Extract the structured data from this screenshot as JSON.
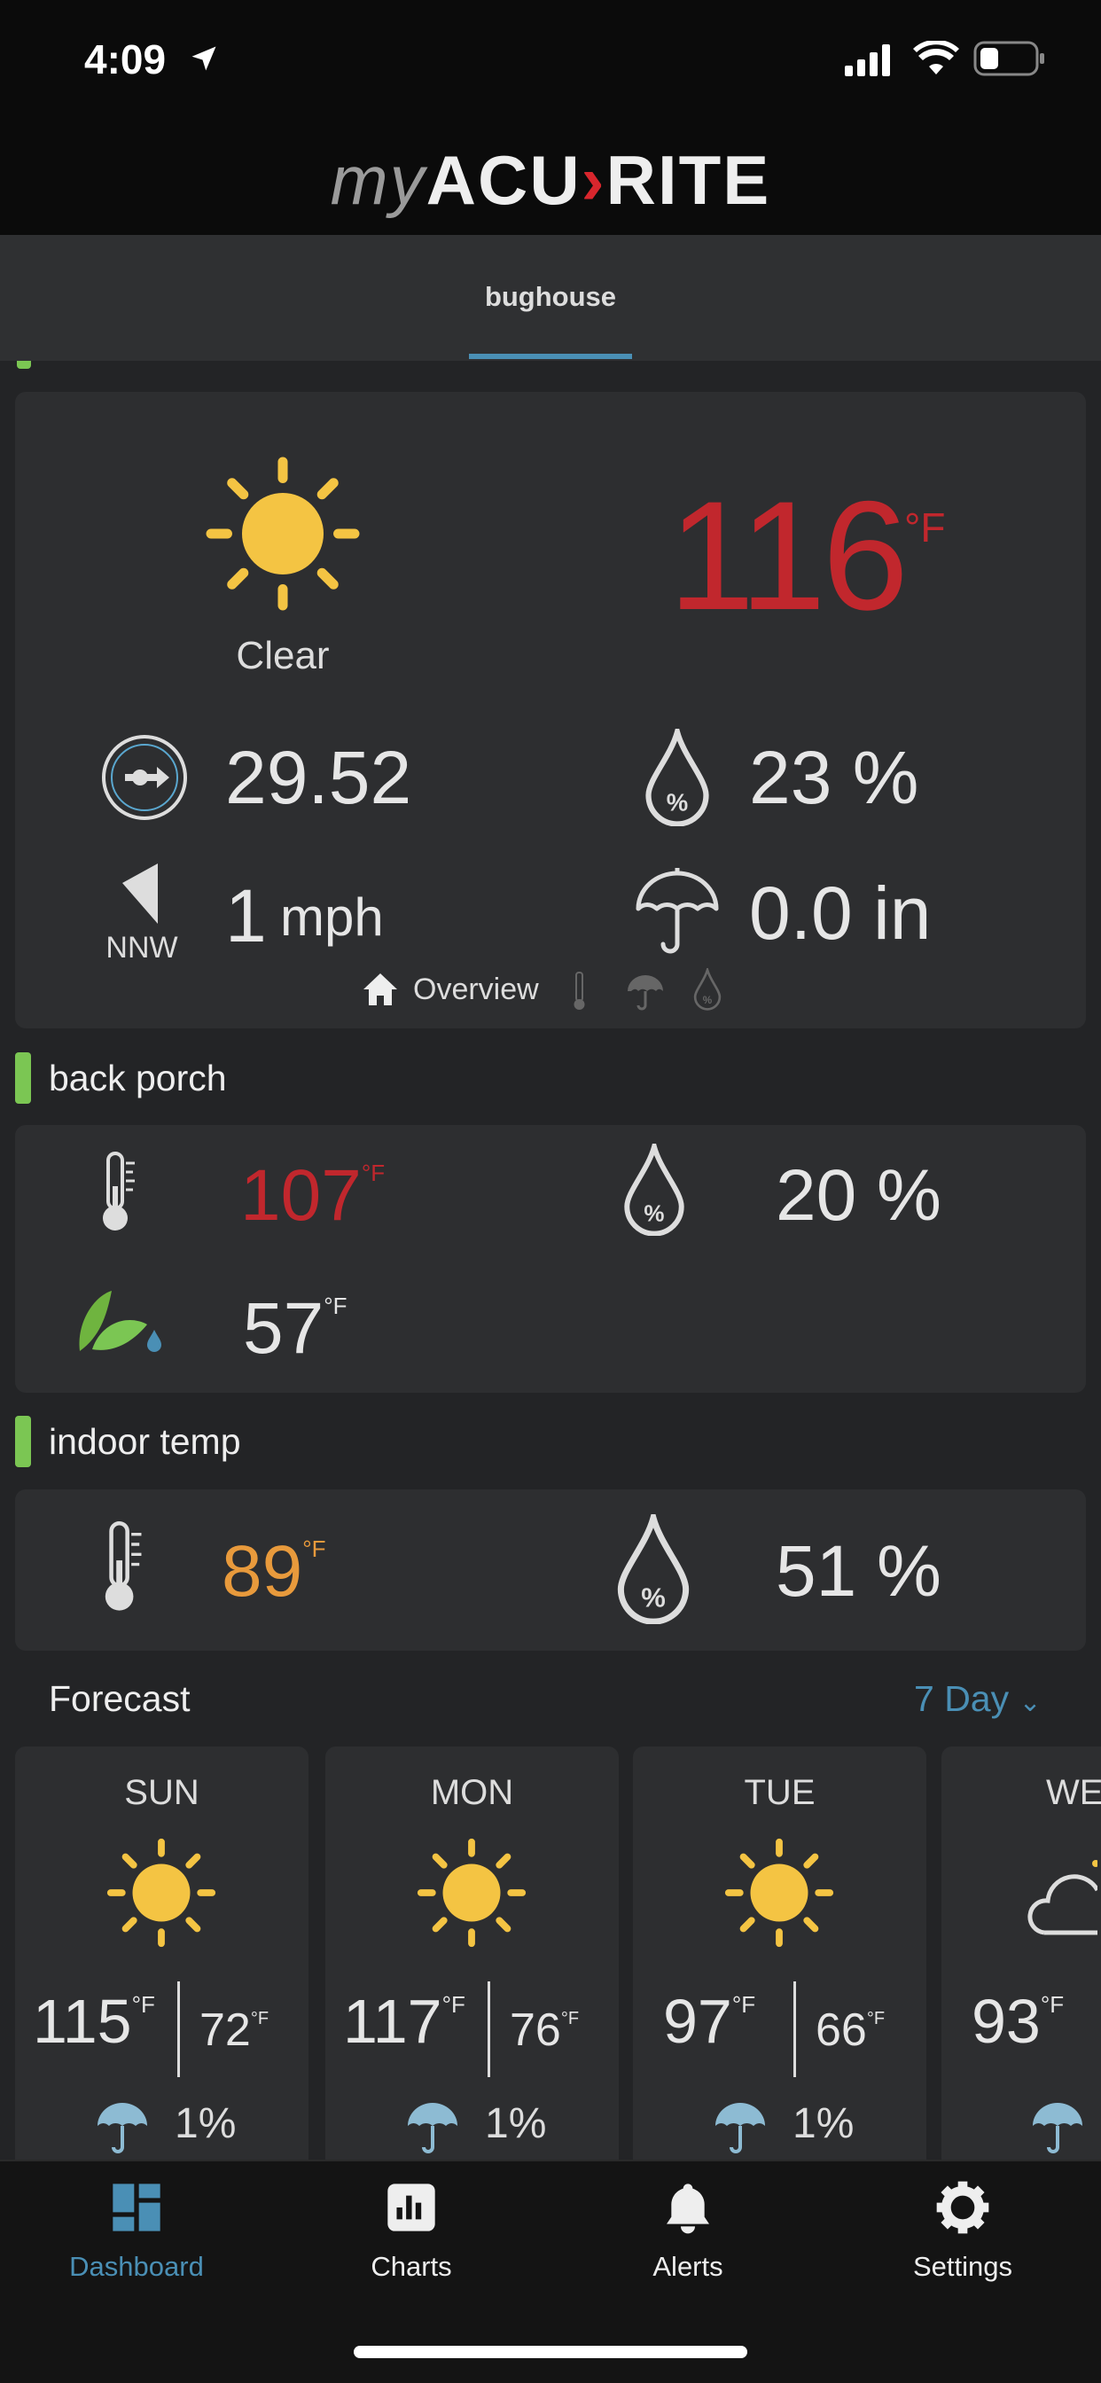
{
  "status_bar": {
    "time": "4:09"
  },
  "header": {
    "logo": {
      "my": "my",
      "acu": "ACU",
      "rite": "RITE"
    }
  },
  "tabs": [
    {
      "label": "bughouse",
      "active": true
    }
  ],
  "overview": {
    "condition": "Clear",
    "condition_icon": "sun-icon",
    "temperature": "116",
    "temp_unit": "°F",
    "temp_color": "#c1272d",
    "pressure": "29.52",
    "humidity": "23 %",
    "wind_speed": "1",
    "wind_unit": "mph",
    "wind_direction": "NNW",
    "rain": "0.0 in",
    "pager_label": "Overview"
  },
  "sensors": [
    {
      "name": "back porch",
      "temperature": "107",
      "temp_unit": "°F",
      "temp_color": "#c1272d",
      "humidity": "20 %",
      "dew_point": "57",
      "dew_unit": "°F"
    },
    {
      "name": "indoor temp",
      "temperature": "89",
      "temp_unit": "°F",
      "temp_color": "#e89a3c",
      "humidity": "51 %"
    }
  ],
  "forecast": {
    "title": "Forecast",
    "range": "7 Day",
    "days": [
      {
        "day": "SUN",
        "icon": "sun-icon",
        "high": "115",
        "low": "72",
        "unit": "°F",
        "rain": "1%"
      },
      {
        "day": "MON",
        "icon": "sun-icon",
        "high": "117",
        "low": "76",
        "unit": "°F",
        "rain": "1%"
      },
      {
        "day": "TUE",
        "icon": "sun-icon",
        "high": "97",
        "low": "66",
        "unit": "°F",
        "rain": "1%"
      },
      {
        "day": "WE",
        "icon": "partly-cloudy-icon",
        "high": "93",
        "unit": "°F"
      }
    ]
  },
  "bottom_nav": [
    {
      "label": "Dashboard",
      "active": true
    },
    {
      "label": "Charts"
    },
    {
      "label": "Alerts"
    },
    {
      "label": "Settings"
    }
  ],
  "colors": {
    "accent": "#4a8fb5",
    "sun": "#f4c443",
    "background": "#232426",
    "card": "#2d2e30",
    "green": "#7bc653"
  }
}
